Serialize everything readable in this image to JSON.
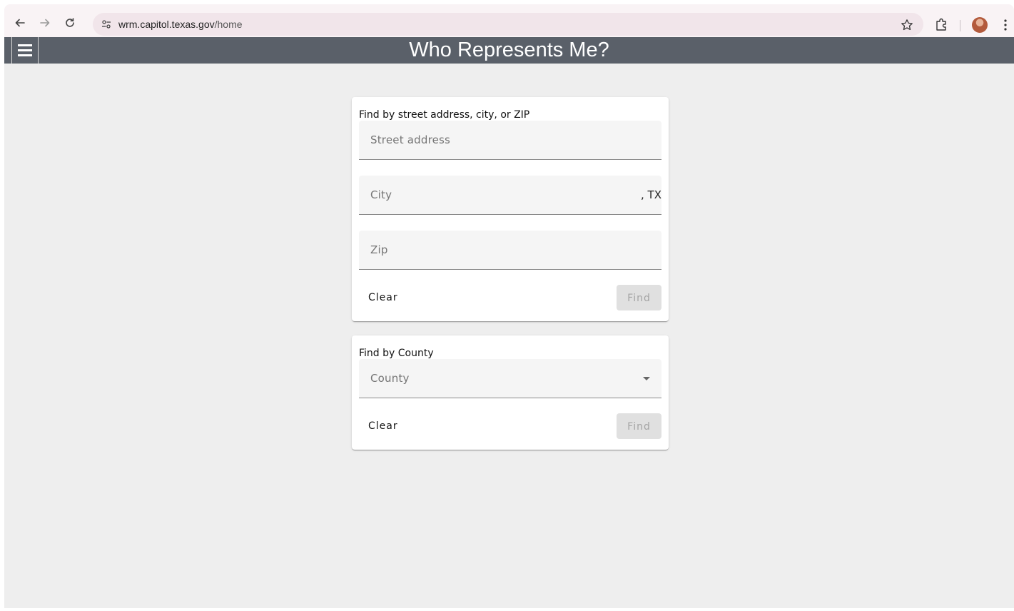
{
  "browser": {
    "url_domain": "wrm.capitol.texas.gov",
    "url_path": "/home",
    "back_icon": "arrow-left-icon",
    "forward_icon": "arrow-right-icon",
    "reload_icon": "reload-icon",
    "site_info_icon": "tune-icon",
    "bookmark_icon": "star-icon",
    "extensions_icon": "puzzle-icon",
    "menu_icon": "kebab-menu-icon"
  },
  "app": {
    "title": "Who Represents Me?",
    "menu_icon": "hamburger-icon",
    "toolbar_color": "#5a6069",
    "background_color": "#eeeeee"
  },
  "address_search": {
    "title": "Find by street address, city, or ZIP",
    "street_placeholder": "Street address",
    "city_placeholder": "City",
    "city_suffix": ", TX",
    "zip_placeholder": "Zip",
    "clear_label": "Clear",
    "find_label": "Find"
  },
  "county_search": {
    "title": "Find by County",
    "county_placeholder": "County",
    "dropdown_icon": "caret-down-icon",
    "clear_label": "Clear",
    "find_label": "Find"
  }
}
